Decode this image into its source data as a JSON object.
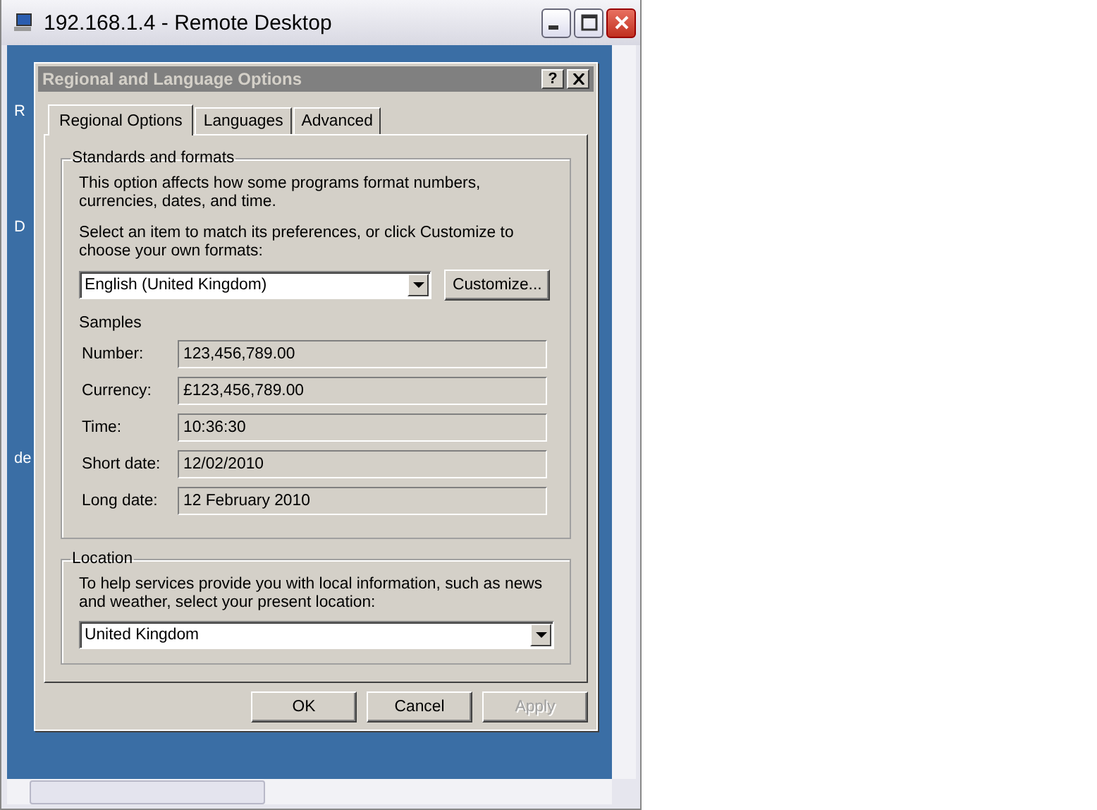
{
  "window": {
    "title": "192.168.1.4 - Remote Desktop"
  },
  "desktop_labels": [
    "R",
    "D",
    "de"
  ],
  "dialog": {
    "title": "Regional and Language Options",
    "help": "?"
  },
  "tabs": [
    {
      "label": "Regional Options",
      "selected": true
    },
    {
      "label": "Languages",
      "selected": false
    },
    {
      "label": "Advanced",
      "selected": false
    }
  ],
  "standards": {
    "legend": "Standards and formats",
    "description": "This option affects how some programs format numbers, currencies, dates, and time.",
    "prompt": "Select an item to match its preferences, or click Customize to choose your own formats:",
    "format": "English (United Kingdom)",
    "customize": "Customize...",
    "samples_heading": "Samples",
    "samples": [
      {
        "label": "Number:",
        "value": "123,456,789.00"
      },
      {
        "label": "Currency:",
        "value": "£123,456,789.00"
      },
      {
        "label": "Time:",
        "value": "10:36:30"
      },
      {
        "label": "Short date:",
        "value": "12/02/2010"
      },
      {
        "label": "Long date:",
        "value": "12 February 2010"
      }
    ]
  },
  "location": {
    "legend": "Location",
    "description": "To help services provide you with local information, such as news and weather, select your present location:",
    "value": "United Kingdom"
  },
  "buttons": [
    {
      "label": "OK",
      "disabled": false
    },
    {
      "label": "Cancel",
      "disabled": false
    },
    {
      "label": "Apply",
      "disabled": true
    }
  ]
}
